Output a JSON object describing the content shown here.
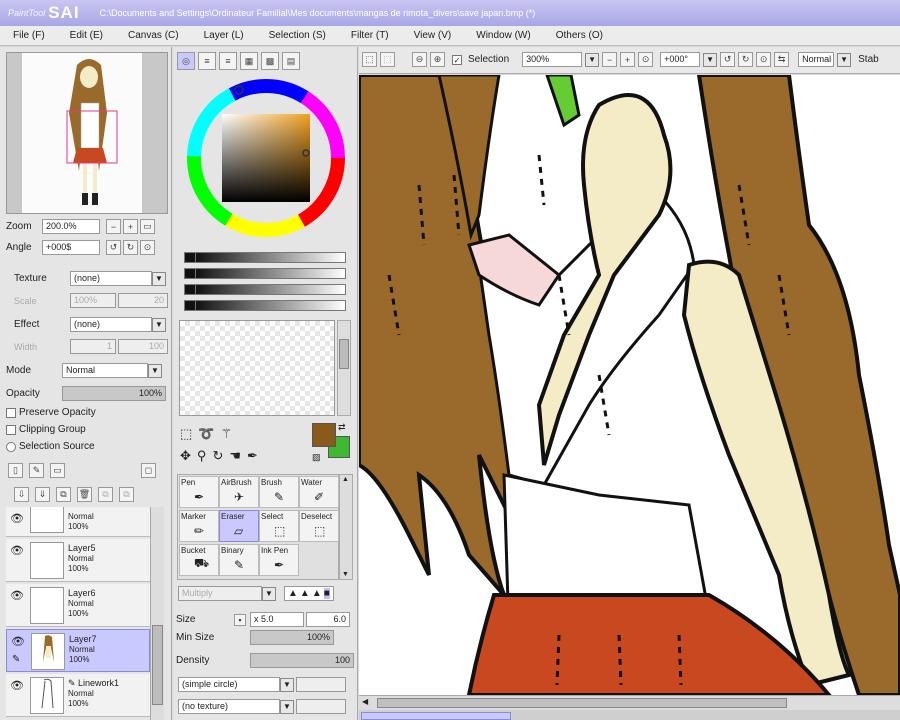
{
  "titlebar": {
    "brand": "PaintTool",
    "app": "SAI",
    "path": "C:\\Documents and Settings\\Ordinateur Familial\\Mes documents\\mangas de rimota_divers\\save japan.bmp (*)"
  },
  "menu": [
    "File (F)",
    "Edit (E)",
    "Canvas (C)",
    "Layer (L)",
    "Selection (S)",
    "Filter (T)",
    "View (V)",
    "Window (W)",
    "Others (O)"
  ],
  "navigator": {
    "zoom_label": "Zoom",
    "zoom_value": "200.0%",
    "angle_label": "Angle",
    "angle_value": "+000$"
  },
  "texture": {
    "label": "Texture",
    "value": "(none)",
    "scale_label": "Scale",
    "scale_value": "100%",
    "strength_value": "20"
  },
  "effect": {
    "label": "Effect",
    "value": "(none)",
    "width_label": "Width",
    "width_value": "1",
    "strength_value": "100"
  },
  "mode": {
    "label": "Mode",
    "value": "Normal"
  },
  "opacity": {
    "label": "Opacity",
    "value": "100%"
  },
  "options": {
    "preserve": "Preserve Opacity",
    "clipping": "Clipping Group",
    "selsource": "Selection Source"
  },
  "layers": [
    {
      "name": "",
      "mode": "Normal",
      "opacity": "100%"
    },
    {
      "name": "Layer5",
      "mode": "Normal",
      "opacity": "100%"
    },
    {
      "name": "Layer6",
      "mode": "Normal",
      "opacity": "100%"
    },
    {
      "name": "Layer7",
      "mode": "Normal",
      "opacity": "100%"
    },
    {
      "name": "Linework1",
      "mode": "Normal",
      "opacity": "100%"
    }
  ],
  "colors": {
    "primary": "#8a5a1a",
    "secondary": "#3fb832",
    "selection_accent": "#c9c9ff",
    "hair": "#9a6a2c",
    "skin": "#f4ecc6",
    "skirt": "#c84820"
  },
  "tools": [
    {
      "label": "Pen",
      "icon": "pen-icon"
    },
    {
      "label": "AirBrush",
      "icon": "airbrush-icon"
    },
    {
      "label": "Brush",
      "icon": "brush-icon"
    },
    {
      "label": "Water",
      "icon": "water-icon"
    },
    {
      "label": "Marker",
      "icon": "marker-icon"
    },
    {
      "label": "Eraser",
      "icon": "eraser-icon"
    },
    {
      "label": "Select",
      "icon": "select-icon"
    },
    {
      "label": "Deselect",
      "icon": "deselect-icon"
    },
    {
      "label": "Bucket",
      "icon": "bucket-icon"
    },
    {
      "label": "Binary",
      "icon": "binary-icon"
    },
    {
      "label": "Ink Pen",
      "icon": "inkpen-icon"
    }
  ],
  "brush": {
    "mode": "Multiply",
    "size_label": "Size",
    "size_mult": "x 5.0",
    "size_value": "6.0",
    "minsize_label": "Min Size",
    "minsize_value": "100%",
    "density_label": "Density",
    "density_value": "100",
    "shape": "(simple circle)",
    "texture": "(no texture)"
  },
  "canvas_toolbar": {
    "selection_label": "Selection",
    "zoom": "300%",
    "angle": "+000°",
    "blend": "Normal",
    "stab": "Stab"
  }
}
